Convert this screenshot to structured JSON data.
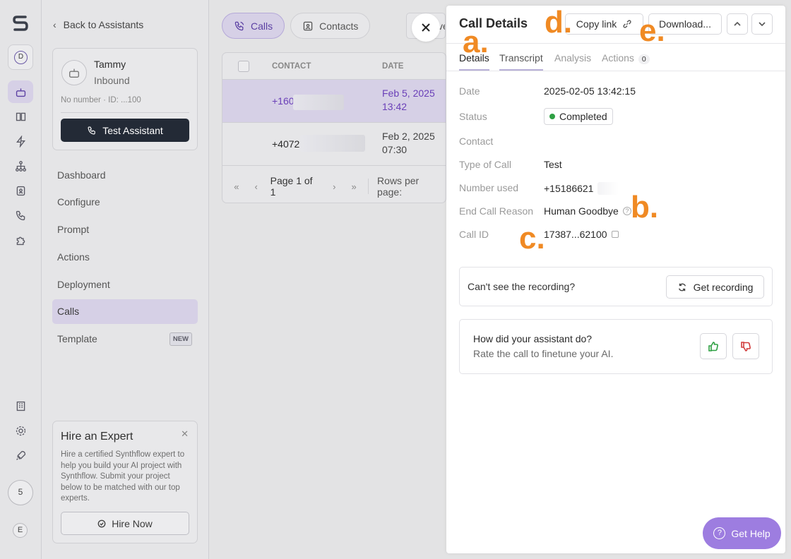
{
  "rail": {
    "workspace_initial": "D",
    "user_number": "5",
    "user_initial": "E"
  },
  "sidebar": {
    "back_label": "Back to Assistants",
    "assistant": {
      "name": "Tammy",
      "direction": "Inbound",
      "number": "No number",
      "id": "ID: ...100",
      "test_button": "Test Assistant"
    },
    "nav": [
      {
        "label": "Dashboard"
      },
      {
        "label": "Configure"
      },
      {
        "label": "Prompt"
      },
      {
        "label": "Actions"
      },
      {
        "label": "Deployment"
      },
      {
        "label": "Calls",
        "active": true
      },
      {
        "label": "Template",
        "badge": "NEW"
      }
    ],
    "expert": {
      "title": "Hire an Expert",
      "description": "Hire a certified Synthflow expert to help you build your AI project with Synthflow. Submit your project below to be matched with our top experts.",
      "button": "Hire Now"
    }
  },
  "main": {
    "tabs": [
      {
        "label": "Calls",
        "active": true
      },
      {
        "label": "Contacts"
      }
    ],
    "stub_button": "ve",
    "table": {
      "columns": [
        "CONTACT",
        "DATE"
      ],
      "rows": [
        {
          "contact": "+160",
          "date_line1": "Feb 5, 2025",
          "date_line2": "13:42",
          "selected": true
        },
        {
          "contact": "+4072",
          "date_line1": "Feb 2, 2025",
          "date_line2": "07:30"
        }
      ],
      "page_label": "Page 1 of 1",
      "rows_per_page": "Rows per page:"
    }
  },
  "panel": {
    "title": "Call Details",
    "copy_link": "Copy link",
    "download": "Download...",
    "tabs": [
      "Details",
      "Transcript",
      "Analysis",
      "Actions"
    ],
    "actions_count": "0",
    "fields": {
      "date_label": "Date",
      "date": "2025-02-05 13:42:15",
      "status_label": "Status",
      "status": "Completed",
      "contact_label": "Contact",
      "contact": "",
      "type_label": "Type of Call",
      "type": "Test",
      "number_label": "Number used",
      "number": "+15186621",
      "reason_label": "End Call Reason",
      "reason": "Human Goodbye",
      "callid_label": "Call ID",
      "callid": "17387...62100"
    },
    "recording": {
      "text": "Can't see the recording?",
      "button": "Get recording"
    },
    "rating": {
      "question": "How did your assistant do?",
      "subtext": "Rate the call to finetune your AI."
    }
  },
  "help_button": "Get Help",
  "annotations": {
    "a": "a.",
    "b": "b.",
    "c": "c.",
    "d": "d.",
    "e": "e."
  },
  "colors": {
    "accent": "#5b3fa3",
    "selected_bg": "#d6d0e6",
    "success": "#2ea043",
    "help": "#9d7de0",
    "annotation": "#f08a24"
  }
}
